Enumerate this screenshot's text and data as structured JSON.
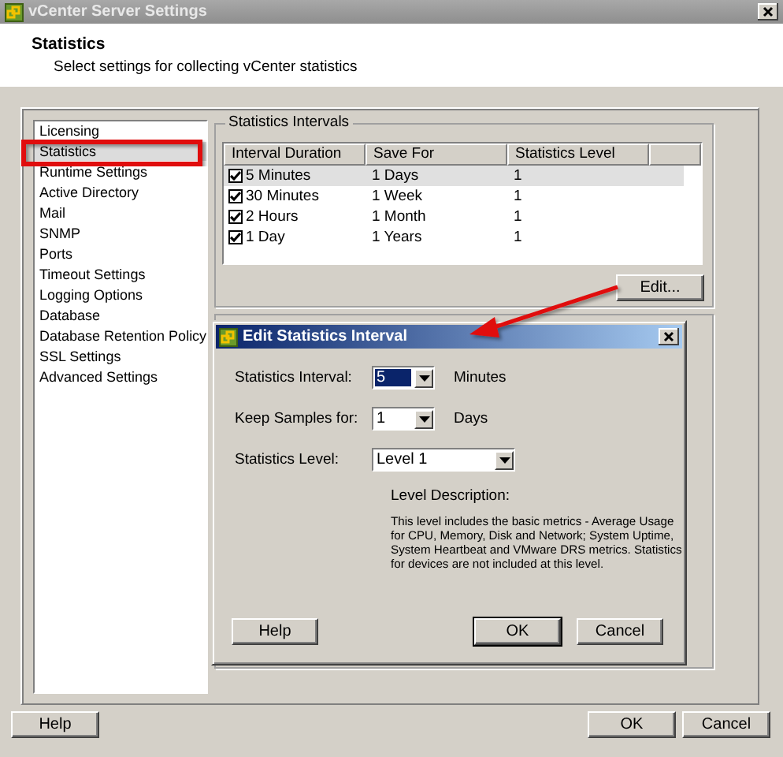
{
  "window": {
    "title": "vCenter Server Settings"
  },
  "header": {
    "title": "Statistics",
    "subtitle": "Select settings for collecting vCenter statistics"
  },
  "sidebar": {
    "items": [
      {
        "label": "Licensing",
        "selected": false
      },
      {
        "label": "Statistics",
        "selected": true
      },
      {
        "label": "Runtime Settings",
        "selected": false
      },
      {
        "label": "Active Directory",
        "selected": false
      },
      {
        "label": "Mail",
        "selected": false
      },
      {
        "label": "SNMP",
        "selected": false
      },
      {
        "label": "Ports",
        "selected": false
      },
      {
        "label": "Timeout Settings",
        "selected": false
      },
      {
        "label": "Logging Options",
        "selected": false
      },
      {
        "label": "Database",
        "selected": false
      },
      {
        "label": "Database Retention Policy",
        "selected": false
      },
      {
        "label": "SSL Settings",
        "selected": false
      },
      {
        "label": "Advanced Settings",
        "selected": false
      }
    ]
  },
  "intervals": {
    "title": "Statistics Intervals",
    "columns": [
      "Interval Duration",
      "Save For",
      "Statistics Level"
    ],
    "rows": [
      {
        "checked": true,
        "selected": true,
        "cells": [
          "5 Minutes",
          "1 Days",
          "1"
        ]
      },
      {
        "checked": true,
        "selected": false,
        "cells": [
          "30 Minutes",
          "1 Week",
          "1"
        ]
      },
      {
        "checked": true,
        "selected": false,
        "cells": [
          "2 Hours",
          "1 Month",
          "1"
        ]
      },
      {
        "checked": true,
        "selected": false,
        "cells": [
          "1 Day",
          "1 Years",
          "1"
        ]
      }
    ],
    "edit_button": "Edit..."
  },
  "footer": {
    "left": [
      "Help"
    ],
    "right": [
      "OK",
      "Cancel"
    ]
  },
  "dialog": {
    "title": "Edit Statistics Interval",
    "fields": [
      {
        "label": "Statistics Interval:",
        "value": "5",
        "unit": "Minutes",
        "focused": true,
        "kind": "short"
      },
      {
        "label": "Keep Samples for:",
        "value": "1",
        "unit": "Days",
        "focused": false,
        "kind": "short"
      },
      {
        "label": "Statistics Level:",
        "value": "Level 1",
        "focused": false,
        "kind": "wide"
      }
    ],
    "description_label": "Level Description:",
    "description": "This level includes the basic metrics - Average Usage for CPU, Memory, Disk and Network; System Uptime, System Heartbeat and VMware DRS metrics. Statistics for devices are not included at this level.",
    "left_buttons": [
      {
        "label": "Help",
        "default": false
      }
    ],
    "right_buttons": [
      {
        "label": "OK",
        "default": true
      },
      {
        "label": "Cancel",
        "default": false
      }
    ]
  }
}
